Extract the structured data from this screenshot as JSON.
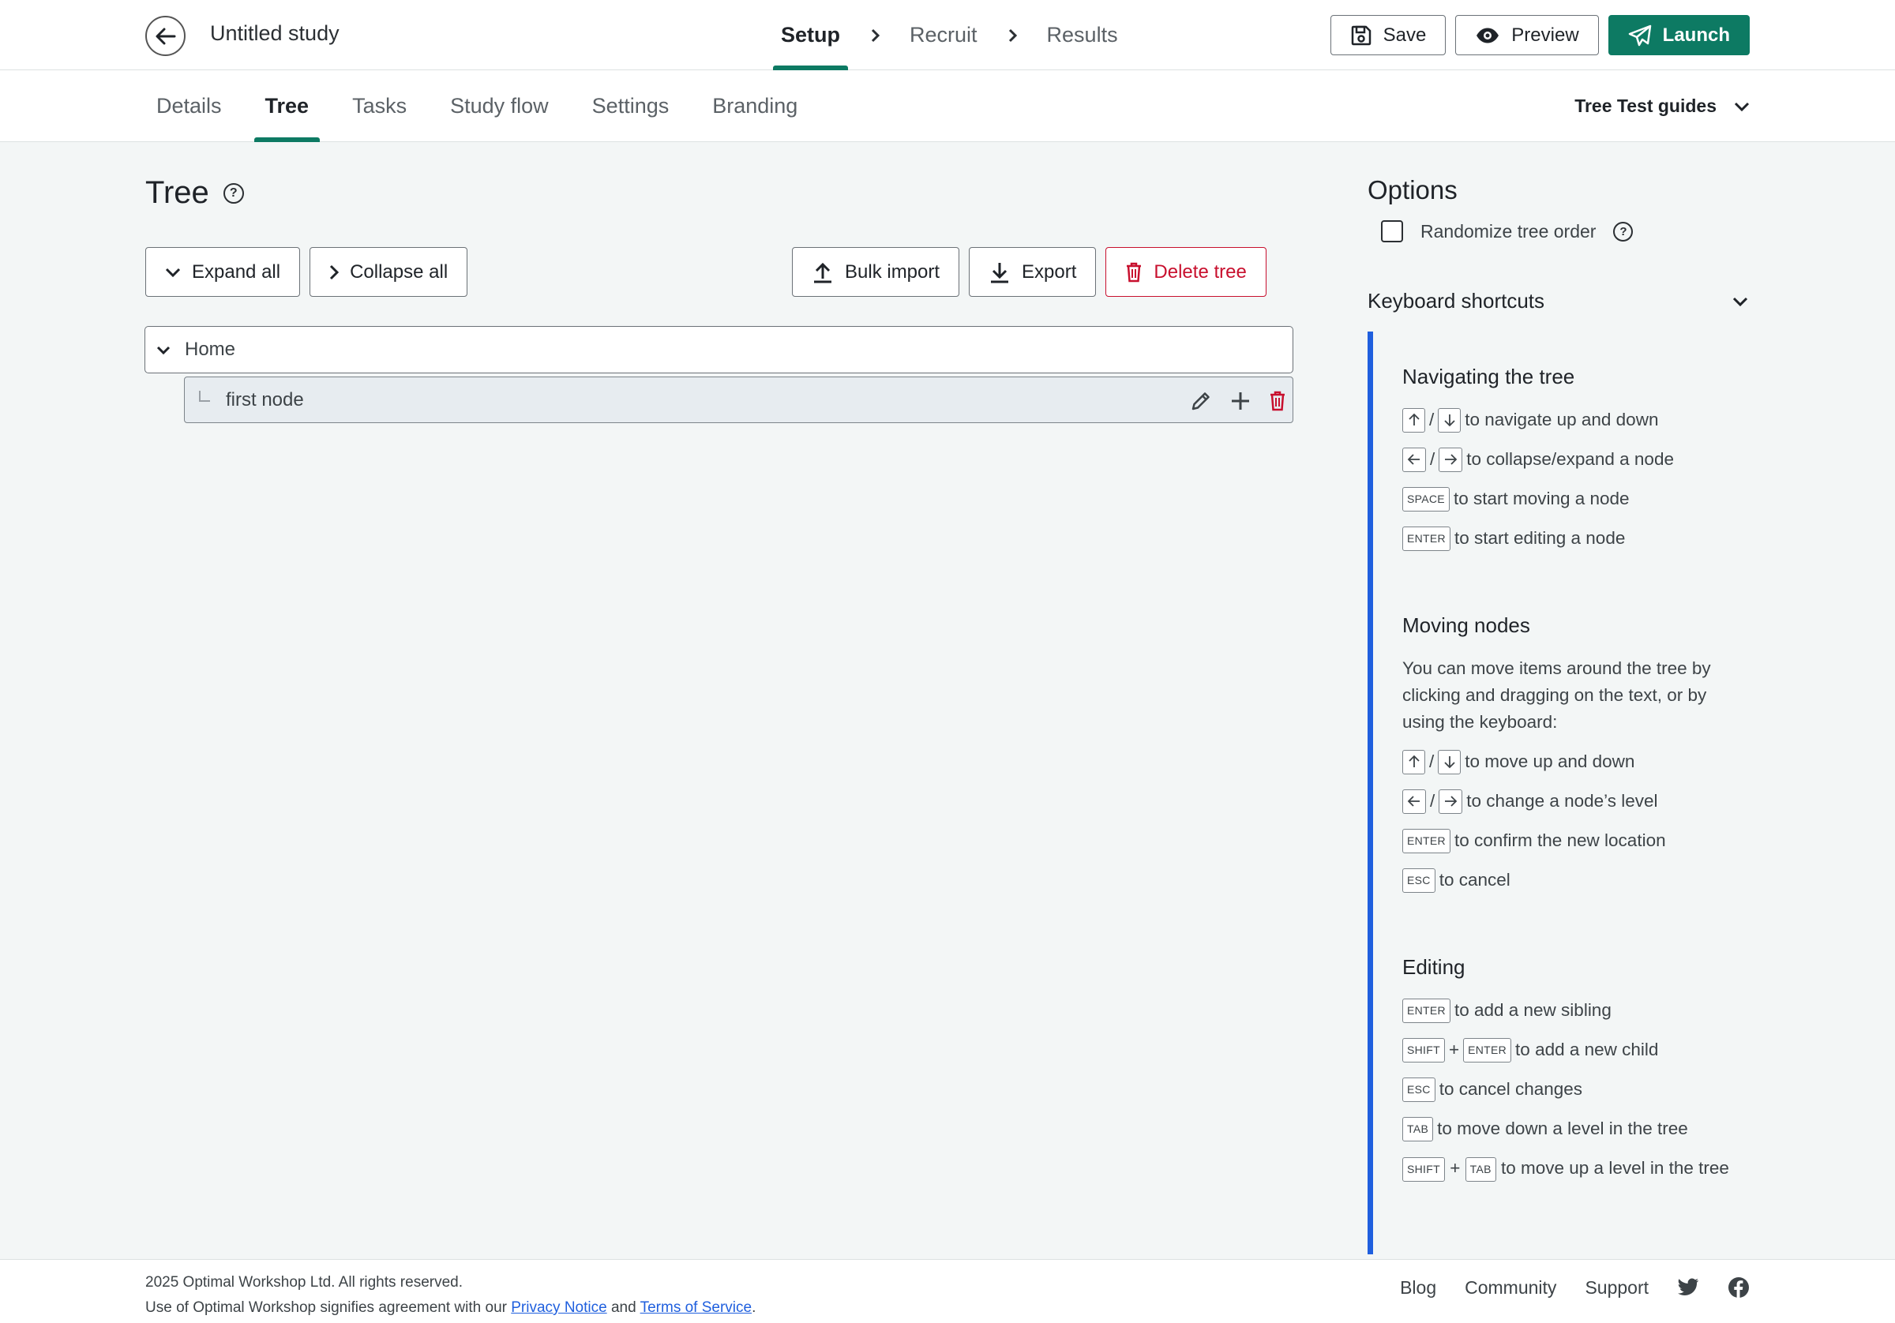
{
  "header": {
    "study_title": "Untitled study",
    "steps": [
      "Setup",
      "Recruit",
      "Results"
    ],
    "save_label": "Save",
    "preview_label": "Preview",
    "launch_label": "Launch",
    "back_icon": "arrow-left-icon"
  },
  "tabs": [
    "Details",
    "Tree",
    "Tasks",
    "Study flow",
    "Settings",
    "Branding"
  ],
  "active_tab": "Tree",
  "guides_label": "Tree Test guides",
  "main": {
    "title": "Tree",
    "expand_label": "Expand all",
    "collapse_label": "Collapse all",
    "bulk_import_label": "Bulk import",
    "export_label": "Export",
    "delete_label": "Delete tree",
    "root_node": "Home",
    "child_node": "first node"
  },
  "options": {
    "title": "Options",
    "randomize_label": "Randomize tree order",
    "randomize_checked": false,
    "shortcuts_title": "Keyboard shortcuts",
    "navigating": {
      "title": "Navigating the tree",
      "updown": "to navigate up and down",
      "leftright": "to collapse/expand a node",
      "space_key": "SPACE",
      "space_text": "to start moving a node",
      "enter_key": "ENTER",
      "enter_text": "to start editing a node"
    },
    "moving": {
      "title": "Moving nodes",
      "desc": "You can move items around the tree by clicking and dragging on the text, or by using the keyboard:",
      "updown": "to move up and down",
      "leftright": "to change a node’s level",
      "enter_key": "ENTER",
      "enter_text": "to confirm the new location",
      "esc_key": "ESC",
      "esc_text": "to cancel"
    },
    "editing": {
      "title": "Editing",
      "enter_key": "ENTER",
      "enter_text": "to add a new sibling",
      "shift_key": "SHIFT",
      "shift_enter_text": "to add a new child",
      "esc_key": "ESC",
      "esc_text": "to cancel changes",
      "tab_key": "TAB",
      "tab_text": "to move down a level in the tree",
      "shift_tab_text": "to move up a level in the tree",
      "plus": "+",
      "slash": "/"
    }
  },
  "footer": {
    "copyright": "2025 Optimal Workshop Ltd. All rights reserved.",
    "agree_prefix": "Use of Optimal Workshop signifies agreement with our",
    "privacy": "Privacy Notice",
    "and": "and",
    "terms": "Terms of Service",
    "period": ".",
    "links": [
      "Blog",
      "Community",
      "Support"
    ]
  },
  "colors": {
    "accent": "#0d7a63",
    "danger": "#c8102e",
    "shortcut_bar": "#1f5fde"
  }
}
